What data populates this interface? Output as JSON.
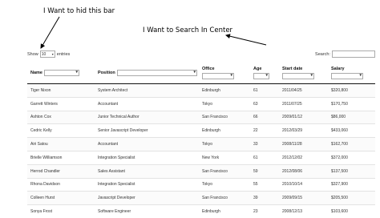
{
  "annotations": {
    "hide_bar": "I Want to hid this bar",
    "search_center": "I Want to Search In Center"
  },
  "length_menu": {
    "show_label": "Show",
    "selected": "10",
    "entries_label": "entries"
  },
  "search": {
    "label": "Search:",
    "value": ""
  },
  "table": {
    "columns": [
      "Name",
      "Position",
      "Office",
      "Age",
      "Start date",
      "Salary"
    ],
    "rows": [
      [
        "Tiger Nixon",
        "System Architect",
        "Edinburgh",
        "61",
        "2011/04/25",
        "$320,800"
      ],
      [
        "Garrett Winters",
        "Accountant",
        "Tokyo",
        "63",
        "2011/07/25",
        "$170,750"
      ],
      [
        "Ashton Cox",
        "Junior Technical Author",
        "San Francisco",
        "66",
        "2009/01/12",
        "$86,000"
      ],
      [
        "Cedric Kelly",
        "Senior Javascript Developer",
        "Edinburgh",
        "22",
        "2012/03/29",
        "$433,060"
      ],
      [
        "Airi Satou",
        "Accountant",
        "Tokyo",
        "33",
        "2008/11/28",
        "$162,700"
      ],
      [
        "Brielle Williamson",
        "Integration Specialist",
        "New York",
        "61",
        "2012/12/02",
        "$372,000"
      ],
      [
        "Herrod Chandler",
        "Sales Assistant",
        "San Francisco",
        "59",
        "2012/08/06",
        "$137,500"
      ],
      [
        "Rhona Davidson",
        "Integration Specialist",
        "Tokyo",
        "55",
        "2010/10/14",
        "$327,900"
      ],
      [
        "Colleen Hurst",
        "Javascript Developer",
        "San Francisco",
        "39",
        "2009/09/15",
        "$205,500"
      ],
      [
        "Sonya Frost",
        "Software Engineer",
        "Edinburgh",
        "23",
        "2008/12/13",
        "$103,600"
      ]
    ]
  }
}
